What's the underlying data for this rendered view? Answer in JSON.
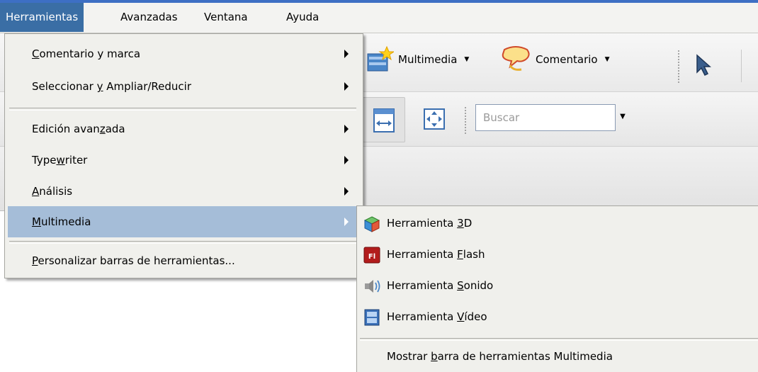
{
  "menubar": {
    "items": [
      {
        "label": "Herramientas",
        "active": true
      },
      {
        "label": "Avanzadas",
        "active": false
      },
      {
        "label": "Ventana",
        "active": false
      },
      {
        "label": "Ayuda",
        "active": false
      }
    ]
  },
  "toolbar": {
    "multimedia_label": "Multimedia",
    "comment_label": "Comentario",
    "search_placeholder": "Buscar"
  },
  "tools_menu": {
    "items": [
      {
        "pre": "",
        "key": "C",
        "post": "omentario y marca",
        "submenu": true
      },
      {
        "pre": "Seleccionar ",
        "key": "y",
        "post": " Ampliar/Reducir",
        "submenu": true
      },
      {
        "pre": "Edición avan",
        "key": "z",
        "post": "ada",
        "submenu": true
      },
      {
        "pre": "Type",
        "key": "w",
        "post": "riter",
        "submenu": true
      },
      {
        "pre": "",
        "key": "A",
        "post": "nálisis",
        "submenu": true
      },
      {
        "pre": "",
        "key": "M",
        "post": "ultimedia",
        "submenu": true,
        "highlighted": true
      },
      {
        "pre": "",
        "key": "P",
        "post": "ersonalizar barras de herramientas...",
        "submenu": false
      }
    ]
  },
  "multimedia_menu": {
    "items": [
      {
        "pre": "Herramienta ",
        "key": "3",
        "post": "D",
        "icon": "3d-tool-icon"
      },
      {
        "pre": "Herramienta ",
        "key": "F",
        "post": "lash",
        "icon": "flash-tool-icon"
      },
      {
        "pre": "Herramienta ",
        "key": "S",
        "post": "onido",
        "icon": "sound-tool-icon"
      },
      {
        "pre": "Herramienta ",
        "key": "V",
        "post": "ídeo",
        "icon": "video-tool-icon"
      },
      {
        "pre": "Mostrar ",
        "key": "b",
        "post": "arra de herramientas Multimedia",
        "icon": ""
      }
    ]
  },
  "colors": {
    "menu_bg": "#f0f0ec",
    "highlight": "#a5bdd8",
    "menubar_active": "#3a6ea5",
    "title_accent": "#3d6fc4"
  }
}
